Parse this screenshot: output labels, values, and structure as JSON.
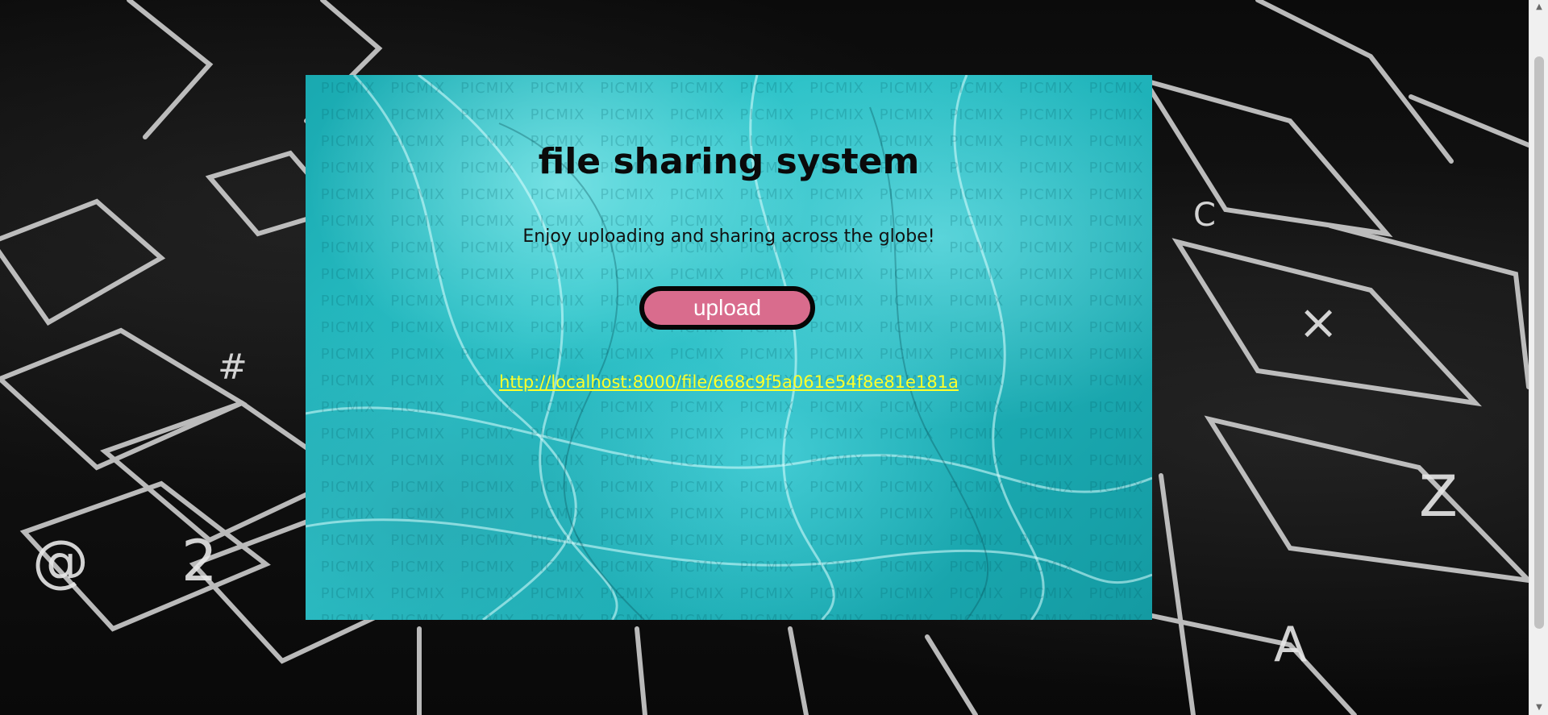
{
  "page": {
    "title": "file sharing system",
    "subtitle": "Enjoy uploading and sharing across the globe!",
    "upload_label": "upload",
    "file_link": "http://localhost:8000/file/668c9f5a061e54f8e81e181a"
  },
  "colors": {
    "card_accent": "#1fb3ba",
    "button_bg": "#d96c8d",
    "button_border": "#060606",
    "link_color": "#ffff2a"
  },
  "icons": {
    "scroll_up": "chevron-up-icon",
    "scroll_down": "chevron-down-icon"
  }
}
